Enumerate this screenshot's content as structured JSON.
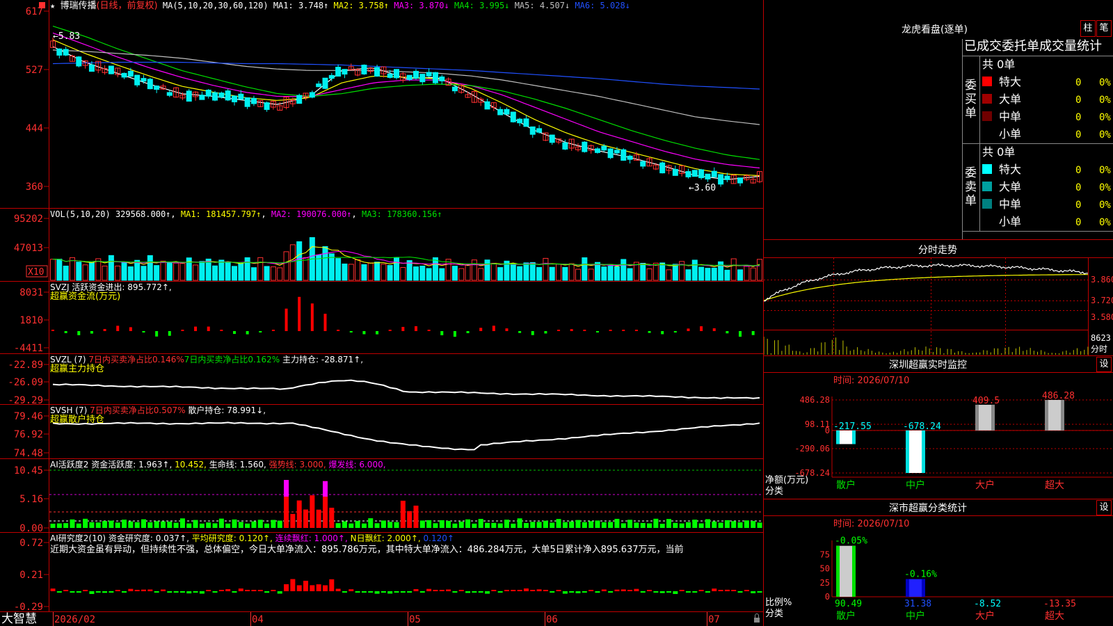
{
  "colors": {
    "up": "#ff3030",
    "down": "#00f0f0",
    "ma1": "#ffffff",
    "ma2": "#ffff00",
    "ma3": "#ff00ff",
    "ma4": "#00e000",
    "ma5": "#c0c0c0",
    "ma6": "#2050ff",
    "grid": "#c00000",
    "axis_text": "#ff3030",
    "green_bar": "#00ff00",
    "red_bar": "#ff0000"
  },
  "header": {
    "star": "★",
    "stock_name": "博瑞传播",
    "period": "(日线，前复权)",
    "ma_params": "MA(5,10,20,30,60,120)",
    "ma1": "MA1: 3.748↑",
    "ma2": "MA2: 3.758↑",
    "ma3": "MA3: 3.870↓",
    "ma4": "MA4: 3.995↓",
    "ma5": "MA5: 4.507↓",
    "ma6": "MA6: 5.028↓"
  },
  "price_axis": [
    "617",
    "527",
    "444",
    "360"
  ],
  "price_annotations": {
    "high": "5.83",
    "low": "3.60"
  },
  "vol_panel": {
    "label": "VOL(5,10,20)",
    "value": "329568.000↑",
    "ma1": "MA1: 181457.797↑",
    "ma2": "MA2: 190076.000↑",
    "ma3": "MA3: 178360.156↑",
    "axis": [
      "95202",
      "47013"
    ],
    "unit": "X10"
  },
  "svzj_panel": {
    "label": "SVZJ  活跃资金进出: 895.772↑,",
    "subtitle": "超赢资金流(万元)",
    "axis": [
      "8031",
      "1810",
      "-4411"
    ]
  },
  "svzl_panel": {
    "label": "SVZL (7)",
    "ratio1": "7日内买卖净占比0.146%",
    "ratio2": "7日内买卖净占比0.162%",
    "hold": "主力持仓: -28.871↑,",
    "subtitle": "超赢主力持仓",
    "axis": [
      "-22.89",
      "-26.09",
      "-29.29"
    ]
  },
  "svsh_panel": {
    "label": "SVSH (7)",
    "ratio": "7日内买卖净占比0.507%",
    "hold": "散户持仓: 78.991↓,",
    "subtitle": "超赢散户持仓",
    "axis": [
      "79.46",
      "76.92",
      "74.48"
    ]
  },
  "ai_active_panel": {
    "label": "AI活跃度2",
    "v1": "资金活跃度: 1.963↑,",
    "v2": "10.452,",
    "v3": "生命线: 1.560,",
    "v4": "强势线: 3.000,",
    "v5": "爆发线: 6.000,",
    "axis": [
      "10.45",
      "5.16",
      "0.00"
    ]
  },
  "ai_research_panel": {
    "label": "AI研究度2(10)",
    "v1": "资金研究度: 0.037↑,",
    "v2": "平均研究度: 0.120↑,",
    "v3": "连续飘红: 1.000↑,",
    "v4": "N日飘红: 2.000↑,",
    "v5": "0.120↑",
    "comment": "近期大资金虽有异动，但持续性不强，总体偏空，今日大单净流入：895.786万元，其中特大单净流入：486.284万元，大单5日累计净入895.637万元，当前",
    "axis": [
      "0.72",
      "0.21",
      "-0.29"
    ]
  },
  "date_axis": {
    "labels": [
      "2026/02",
      "04",
      "05",
      "06",
      "07"
    ],
    "brand": "大智慧"
  },
  "dragon_tiger": {
    "title": "龙虎看盘(逐单)",
    "tab1": "柱",
    "tab2": "笔",
    "headline": "已成交委托单成交量统计",
    "buy_label": "委买单",
    "sell_label": "委卖单",
    "buy_total": "共 0单",
    "sell_total": "共 0单",
    "buy_rows": [
      {
        "name": "特大",
        "count": "0",
        "pct": "0%",
        "color": "#ff0000"
      },
      {
        "name": "大单",
        "count": "0",
        "pct": "0%",
        "color": "#a00000"
      },
      {
        "name": "中单",
        "count": "0",
        "pct": "0%",
        "color": "#700000"
      },
      {
        "name": "小单",
        "count": "0",
        "pct": "0%",
        "color": "#000000"
      }
    ],
    "sell_rows": [
      {
        "name": "特大",
        "count": "0",
        "pct": "0%",
        "color": "#00ffff"
      },
      {
        "name": "大单",
        "count": "0",
        "pct": "0%",
        "color": "#00a0a0"
      },
      {
        "name": "中单",
        "count": "0",
        "pct": "0%",
        "color": "#008080"
      },
      {
        "name": "小单",
        "count": "0",
        "pct": "0%",
        "color": "#000000"
      }
    ]
  },
  "intraday": {
    "title": "分时走势",
    "axis": [
      "3.860",
      "3.720",
      "3.580"
    ],
    "vol_axis": "8623",
    "unit": "分时"
  },
  "sz_monitor": {
    "title": "深圳超赢实时监控",
    "set": "设",
    "time": "时间: 2026/07/10",
    "axis": [
      "486.28",
      "98.11",
      "0",
      "-290.06",
      "-678.24"
    ],
    "ylabel": "净额(万元)",
    "xlabel": "分类"
  },
  "sz_stats": {
    "title": "深市超赢分类统计",
    "set": "设",
    "time": "时间: 2026/07/10",
    "axis": [
      "75",
      "50",
      "25",
      "0"
    ],
    "ylabel": "比例%",
    "xlabel": "分类"
  },
  "chart_data": [
    {
      "type": "bar",
      "title": "深圳超赢实时监控",
      "ylabel": "净额(万元)",
      "xlabel": "分类",
      "categories": [
        "散户",
        "中户",
        "大户",
        "超大"
      ],
      "values": [
        -217.55,
        -678.24,
        409.5,
        486.28
      ],
      "ylim": [
        -678.24,
        486.28
      ]
    },
    {
      "type": "bar",
      "title": "深市超赢分类统计",
      "ylabel": "比例%",
      "xlabel": "分类",
      "categories": [
        "散户",
        "中户",
        "大户",
        "超大"
      ],
      "values": [
        90.49,
        31.38,
        -8.52,
        -13.35
      ],
      "top_labels": [
        "-0.05%",
        "-0.16%",
        "",
        ""
      ],
      "ylim": [
        0,
        100
      ]
    },
    {
      "type": "line",
      "title": "博瑞传播(日线，前复权)",
      "x": [
        "2026/02",
        "04",
        "05",
        "06",
        "07"
      ],
      "series": [
        {
          "name": "MA1",
          "values": [
            5.65,
            5.42,
            5.26,
            5.1,
            4.96,
            4.92,
            4.86,
            4.8,
            4.92,
            5.3,
            5.34,
            5.18,
            5.2,
            4.96,
            4.68,
            4.42,
            4.24,
            4.12,
            4.02,
            3.9,
            3.76,
            3.7,
            3.748
          ]
        },
        {
          "name": "MA2",
          "values": [
            5.75,
            5.55,
            5.38,
            5.22,
            5.07,
            4.98,
            4.9,
            4.86,
            4.9,
            5.12,
            5.22,
            5.2,
            5.18,
            5.04,
            4.82,
            4.58,
            4.38,
            4.22,
            4.1,
            3.98,
            3.86,
            3.78,
            3.758
          ]
        },
        {
          "name": "MA3",
          "values": [
            5.85,
            5.68,
            5.5,
            5.34,
            5.2,
            5.08,
            4.98,
            4.92,
            4.92,
            5.02,
            5.12,
            5.16,
            5.16,
            5.08,
            4.94,
            4.76,
            4.58,
            4.4,
            4.26,
            4.12,
            4.0,
            3.92,
            3.87
          ]
        },
        {
          "name": "MA4",
          "values": [
            5.95,
            5.8,
            5.62,
            5.46,
            5.3,
            5.18,
            5.06,
            4.96,
            4.92,
            4.96,
            5.04,
            5.08,
            5.1,
            5.08,
            5.0,
            4.88,
            4.74,
            4.58,
            4.42,
            4.28,
            4.16,
            4.06,
            3.995
          ]
        },
        {
          "name": "MA5",
          "values": [
            5.6,
            5.58,
            5.55,
            5.52,
            5.48,
            5.42,
            5.36,
            5.32,
            5.3,
            5.3,
            5.3,
            5.28,
            5.26,
            5.22,
            5.16,
            5.08,
            5.0,
            4.92,
            4.82,
            4.72,
            4.62,
            4.56,
            4.507
          ]
        },
        {
          "name": "MA6",
          "values": [
            5.4,
            5.41,
            5.42,
            5.42,
            5.42,
            5.41,
            5.4,
            5.4,
            5.39,
            5.38,
            5.36,
            5.34,
            5.32,
            5.3,
            5.27,
            5.24,
            5.21,
            5.18,
            5.14,
            5.1,
            5.07,
            5.05,
            5.028
          ]
        }
      ],
      "ylim": [
        3.3,
        6.3
      ]
    }
  ]
}
